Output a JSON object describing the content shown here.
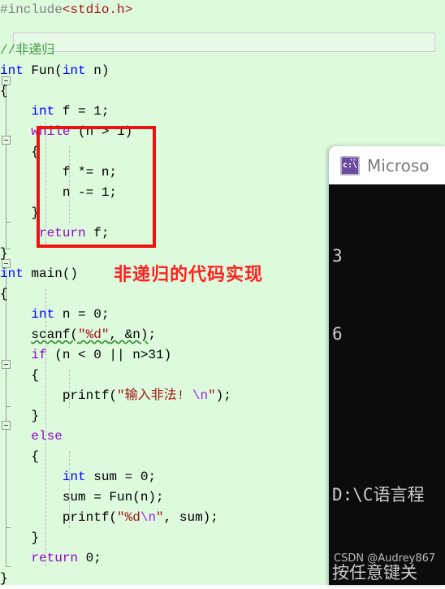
{
  "editor": {
    "background_color": "#ddfadd",
    "current_line_marker": "",
    "lines": [
      {
        "id": "line-include",
        "segments": [
          {
            "t": "#include",
            "c": "pre"
          },
          {
            "t": "<stdio.h>",
            "c": "hdr"
          }
        ]
      },
      {
        "id": "line-blank-1",
        "segments": [
          {
            "t": "",
            "c": "plain"
          }
        ]
      },
      {
        "id": "line-comment",
        "segments": [
          {
            "t": "//非递归",
            "c": "cmt"
          }
        ]
      },
      {
        "id": "line-fun-sig",
        "segments": [
          {
            "t": "int",
            "c": "kw"
          },
          {
            "t": " Fun(",
            "c": "plain"
          },
          {
            "t": "int",
            "c": "kw"
          },
          {
            "t": " n)",
            "c": "plain"
          }
        ]
      },
      {
        "id": "line-fun-open",
        "segments": [
          {
            "t": "{",
            "c": "plain"
          }
        ]
      },
      {
        "id": "line-decl-f",
        "segments": [
          {
            "t": "    ",
            "c": "plain"
          },
          {
            "t": "int",
            "c": "kw"
          },
          {
            "t": " f = 1;",
            "c": "plain"
          }
        ]
      },
      {
        "id": "line-while",
        "segments": [
          {
            "t": "    ",
            "c": "plain"
          },
          {
            "t": "while",
            "c": "kw2"
          },
          {
            "t": " (n > 1)",
            "c": "plain"
          }
        ]
      },
      {
        "id": "line-while-open",
        "segments": [
          {
            "t": "    {",
            "c": "plain"
          }
        ]
      },
      {
        "id": "line-mul",
        "segments": [
          {
            "t": "        f *= n;",
            "c": "plain"
          }
        ]
      },
      {
        "id": "line-dec",
        "segments": [
          {
            "t": "        n -= 1;",
            "c": "plain"
          }
        ]
      },
      {
        "id": "line-while-close",
        "segments": [
          {
            "t": "    }",
            "c": "plain"
          }
        ]
      },
      {
        "id": "line-return-f",
        "segments": [
          {
            "t": "     ",
            "c": "plain"
          },
          {
            "t": "return",
            "c": "kw2"
          },
          {
            "t": " f;",
            "c": "plain"
          }
        ]
      },
      {
        "id": "line-fun-close",
        "segments": [
          {
            "t": "}",
            "c": "plain"
          }
        ]
      },
      {
        "id": "line-main-sig",
        "segments": [
          {
            "t": "int",
            "c": "kw"
          },
          {
            "t": " main()",
            "c": "plain"
          }
        ]
      },
      {
        "id": "line-main-open",
        "segments": [
          {
            "t": "{",
            "c": "plain"
          }
        ]
      },
      {
        "id": "line-decl-n",
        "segments": [
          {
            "t": "    ",
            "c": "plain"
          },
          {
            "t": "int",
            "c": "kw"
          },
          {
            "t": " n = 0;",
            "c": "plain"
          }
        ]
      },
      {
        "id": "line-scanf",
        "segments": [
          {
            "t": "    ",
            "c": "plain"
          },
          {
            "t": "scanf(",
            "c": "plain squiggle"
          },
          {
            "t": "\"%d\"",
            "c": "str squiggle"
          },
          {
            "t": ", &n)",
            "c": "plain squiggle"
          },
          {
            "t": ";",
            "c": "plain"
          }
        ]
      },
      {
        "id": "line-if",
        "segments": [
          {
            "t": "    ",
            "c": "plain"
          },
          {
            "t": "if",
            "c": "kw2"
          },
          {
            "t": " (n < 0 || n>31)",
            "c": "plain"
          }
        ]
      },
      {
        "id": "line-if-open",
        "segments": [
          {
            "t": "    {",
            "c": "plain"
          }
        ]
      },
      {
        "id": "line-printf-err",
        "segments": [
          {
            "t": "        printf(",
            "c": "plain"
          },
          {
            "t": "\"输入非法! ",
            "c": "str"
          },
          {
            "t": "\\n",
            "c": "esc"
          },
          {
            "t": "\"",
            "c": "str"
          },
          {
            "t": ");",
            "c": "plain"
          }
        ]
      },
      {
        "id": "line-if-close",
        "segments": [
          {
            "t": "    }",
            "c": "plain"
          }
        ]
      },
      {
        "id": "line-else",
        "segments": [
          {
            "t": "    ",
            "c": "plain"
          },
          {
            "t": "else",
            "c": "kw2"
          }
        ]
      },
      {
        "id": "line-else-open",
        "segments": [
          {
            "t": "    {",
            "c": "plain"
          }
        ]
      },
      {
        "id": "line-decl-sum",
        "segments": [
          {
            "t": "        ",
            "c": "plain"
          },
          {
            "t": "int",
            "c": "kw"
          },
          {
            "t": " sum = 0;",
            "c": "plain"
          }
        ]
      },
      {
        "id": "line-call-fun",
        "segments": [
          {
            "t": "        sum = Fun(n);",
            "c": "plain"
          }
        ]
      },
      {
        "id": "line-printf-sum",
        "segments": [
          {
            "t": "        printf(",
            "c": "plain"
          },
          {
            "t": "\"%d",
            "c": "str"
          },
          {
            "t": "\\n",
            "c": "esc"
          },
          {
            "t": "\"",
            "c": "str"
          },
          {
            "t": ", sum);",
            "c": "plain"
          }
        ]
      },
      {
        "id": "line-else-close",
        "segments": [
          {
            "t": "    }",
            "c": "plain"
          }
        ]
      },
      {
        "id": "line-return-0",
        "segments": [
          {
            "t": "    ",
            "c": "plain"
          },
          {
            "t": "return",
            "c": "kw2"
          },
          {
            "t": " 0;",
            "c": "plain"
          }
        ]
      },
      {
        "id": "line-main-close",
        "segments": [
          {
            "t": "}",
            "c": "plain"
          }
        ]
      }
    ]
  },
  "annotation": {
    "text": "非递归的代码实现",
    "color": "#ff2020"
  },
  "highlight_box": {
    "color": "#ee1111",
    "label": "non-recursive-loop-block"
  },
  "console": {
    "title": "Microso",
    "icon": "cmd-icon",
    "icon_text": "c:\\",
    "output_lines": [
      "3",
      "6"
    ],
    "path_line": "D:\\C语言程",
    "prompt_line": "按任意键关",
    "watermark": "CSDN @Audrey867",
    "background_color": "#0c0c0c",
    "text_color": "#cccccc"
  }
}
